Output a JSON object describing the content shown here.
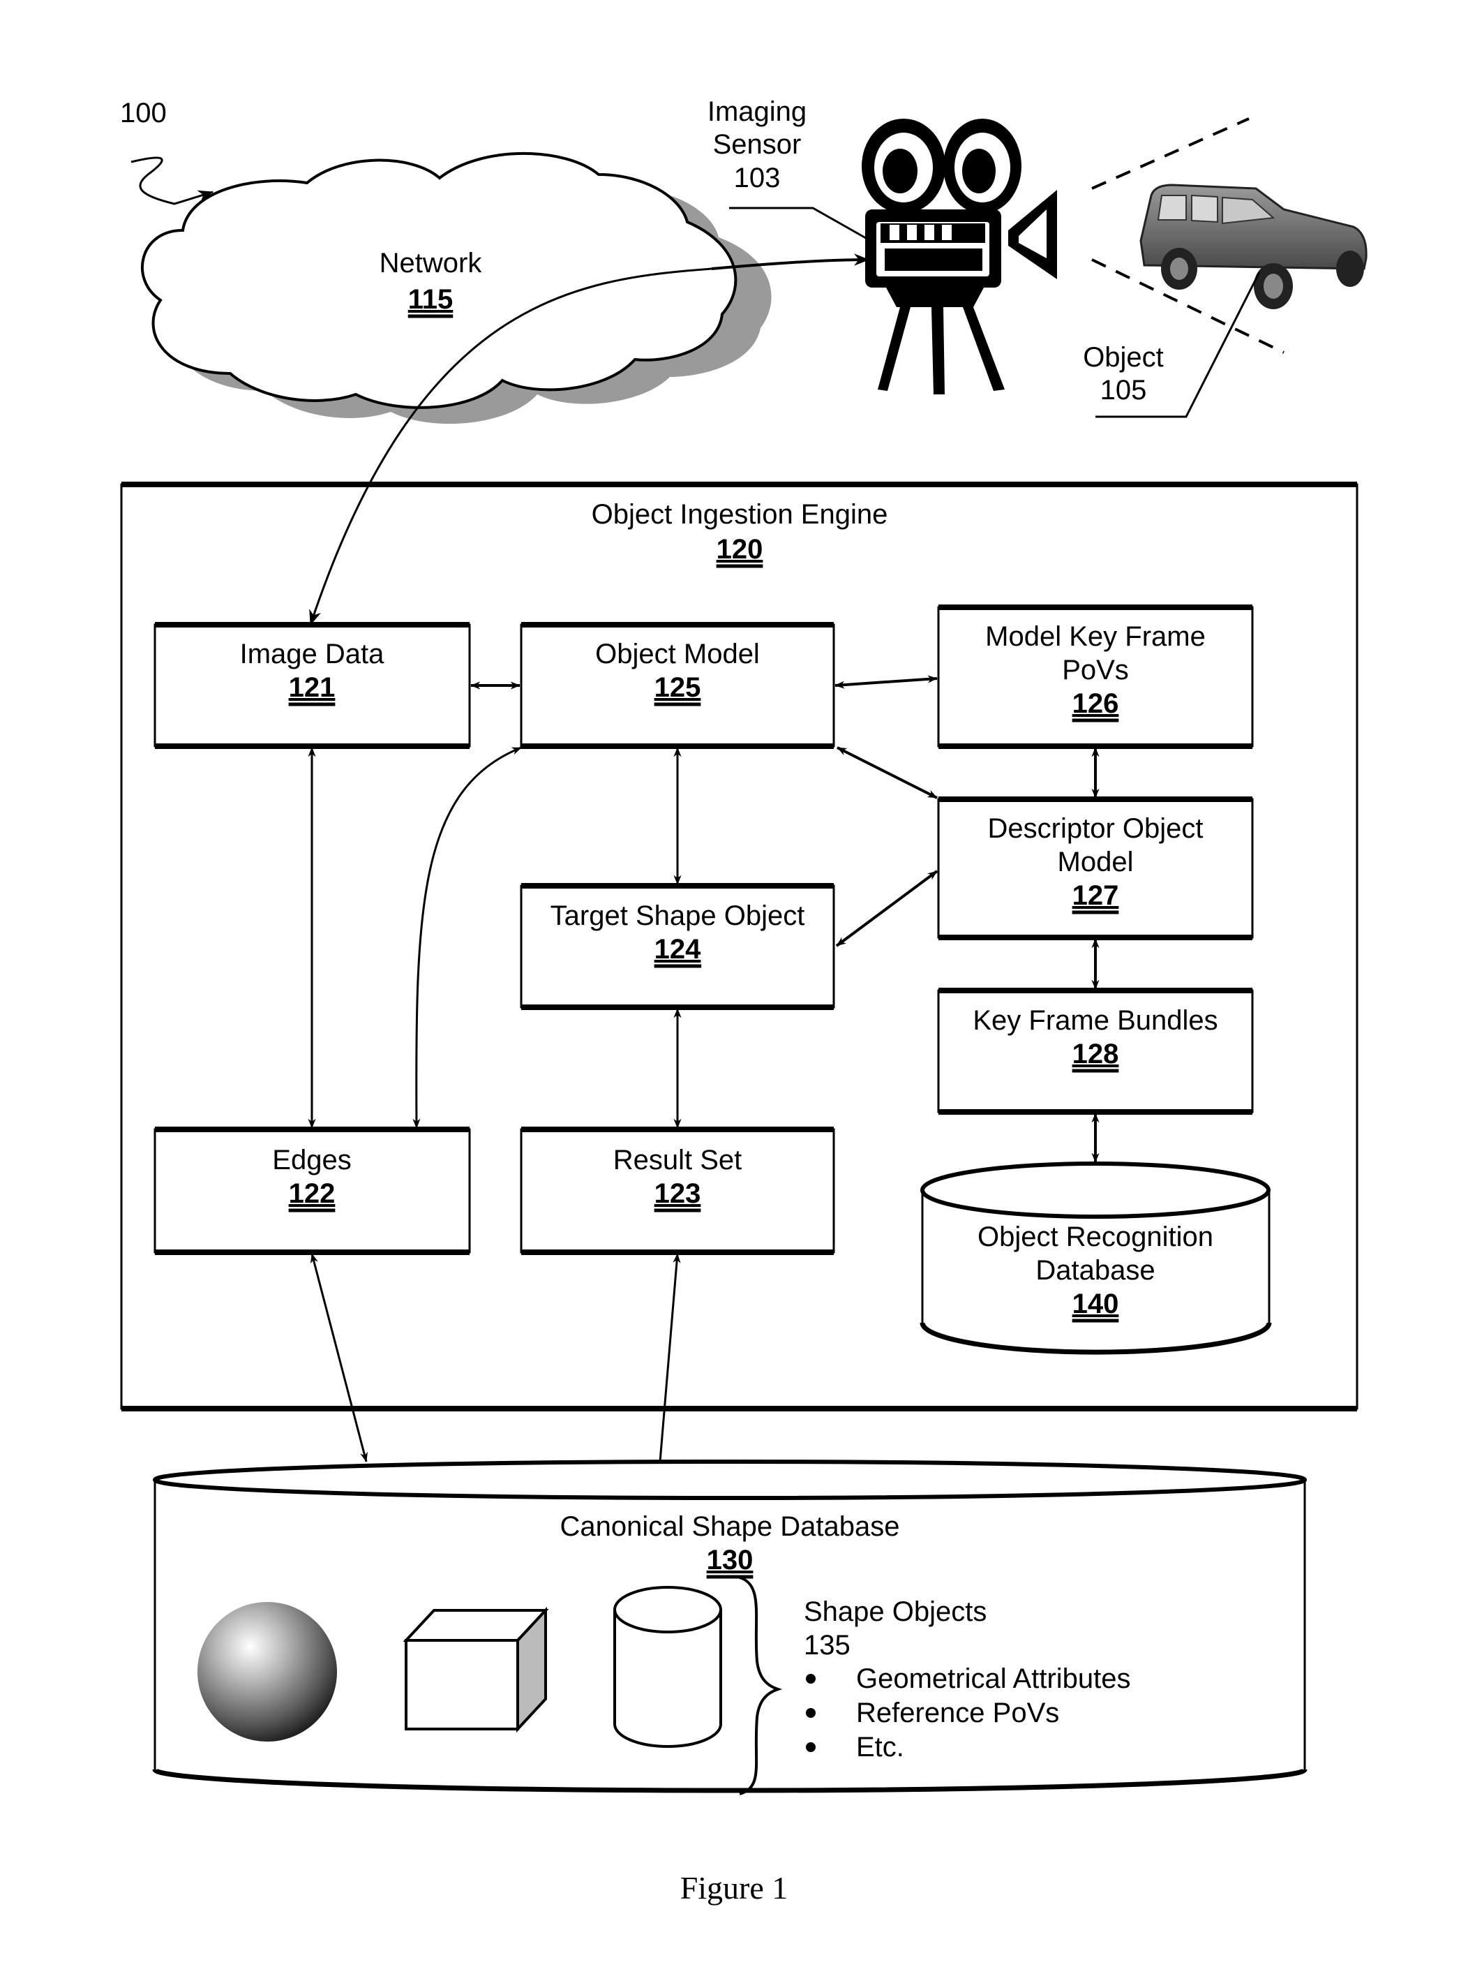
{
  "figure": {
    "ref": "100",
    "caption": "Figure 1"
  },
  "network": {
    "label": "Network",
    "num": "115"
  },
  "sensor": {
    "label_line1": "Imaging",
    "label_line2": "Sensor",
    "num": "103"
  },
  "object": {
    "label": "Object",
    "num": "105"
  },
  "engine": {
    "label": "Object Ingestion Engine",
    "num": "120"
  },
  "boxes": {
    "image_data": {
      "label": "Image Data",
      "num": "121"
    },
    "object_model": {
      "label": "Object Model",
      "num": "125"
    },
    "model_key_frame": {
      "line1": "Model Key Frame",
      "line2": "PoVs",
      "num": "126"
    },
    "descriptor": {
      "line1": "Descriptor Object",
      "line2": "Model",
      "num": "127"
    },
    "target_shape": {
      "label": "Target Shape Object",
      "num": "124"
    },
    "key_frame_bundles": {
      "label": "Key Frame Bundles",
      "num": "128"
    },
    "edges": {
      "label": "Edges",
      "num": "122"
    },
    "result_set": {
      "label": "Result Set",
      "num": "123"
    }
  },
  "ordb": {
    "line1": "Object Recognition",
    "line2": "Database",
    "num": "140"
  },
  "canonical_db": {
    "label": "Canonical Shape Database",
    "num": "130",
    "shape_objects_label": "Shape Objects",
    "shape_objects_num": "135",
    "bullets": [
      "Geometrical Attributes",
      "Reference PoVs",
      "Etc."
    ]
  },
  "icons": [
    "cloud-icon",
    "movie-camera-icon",
    "suv-car-icon",
    "sphere-icon",
    "cube-icon",
    "cylinder-icon",
    "brace-icon"
  ]
}
